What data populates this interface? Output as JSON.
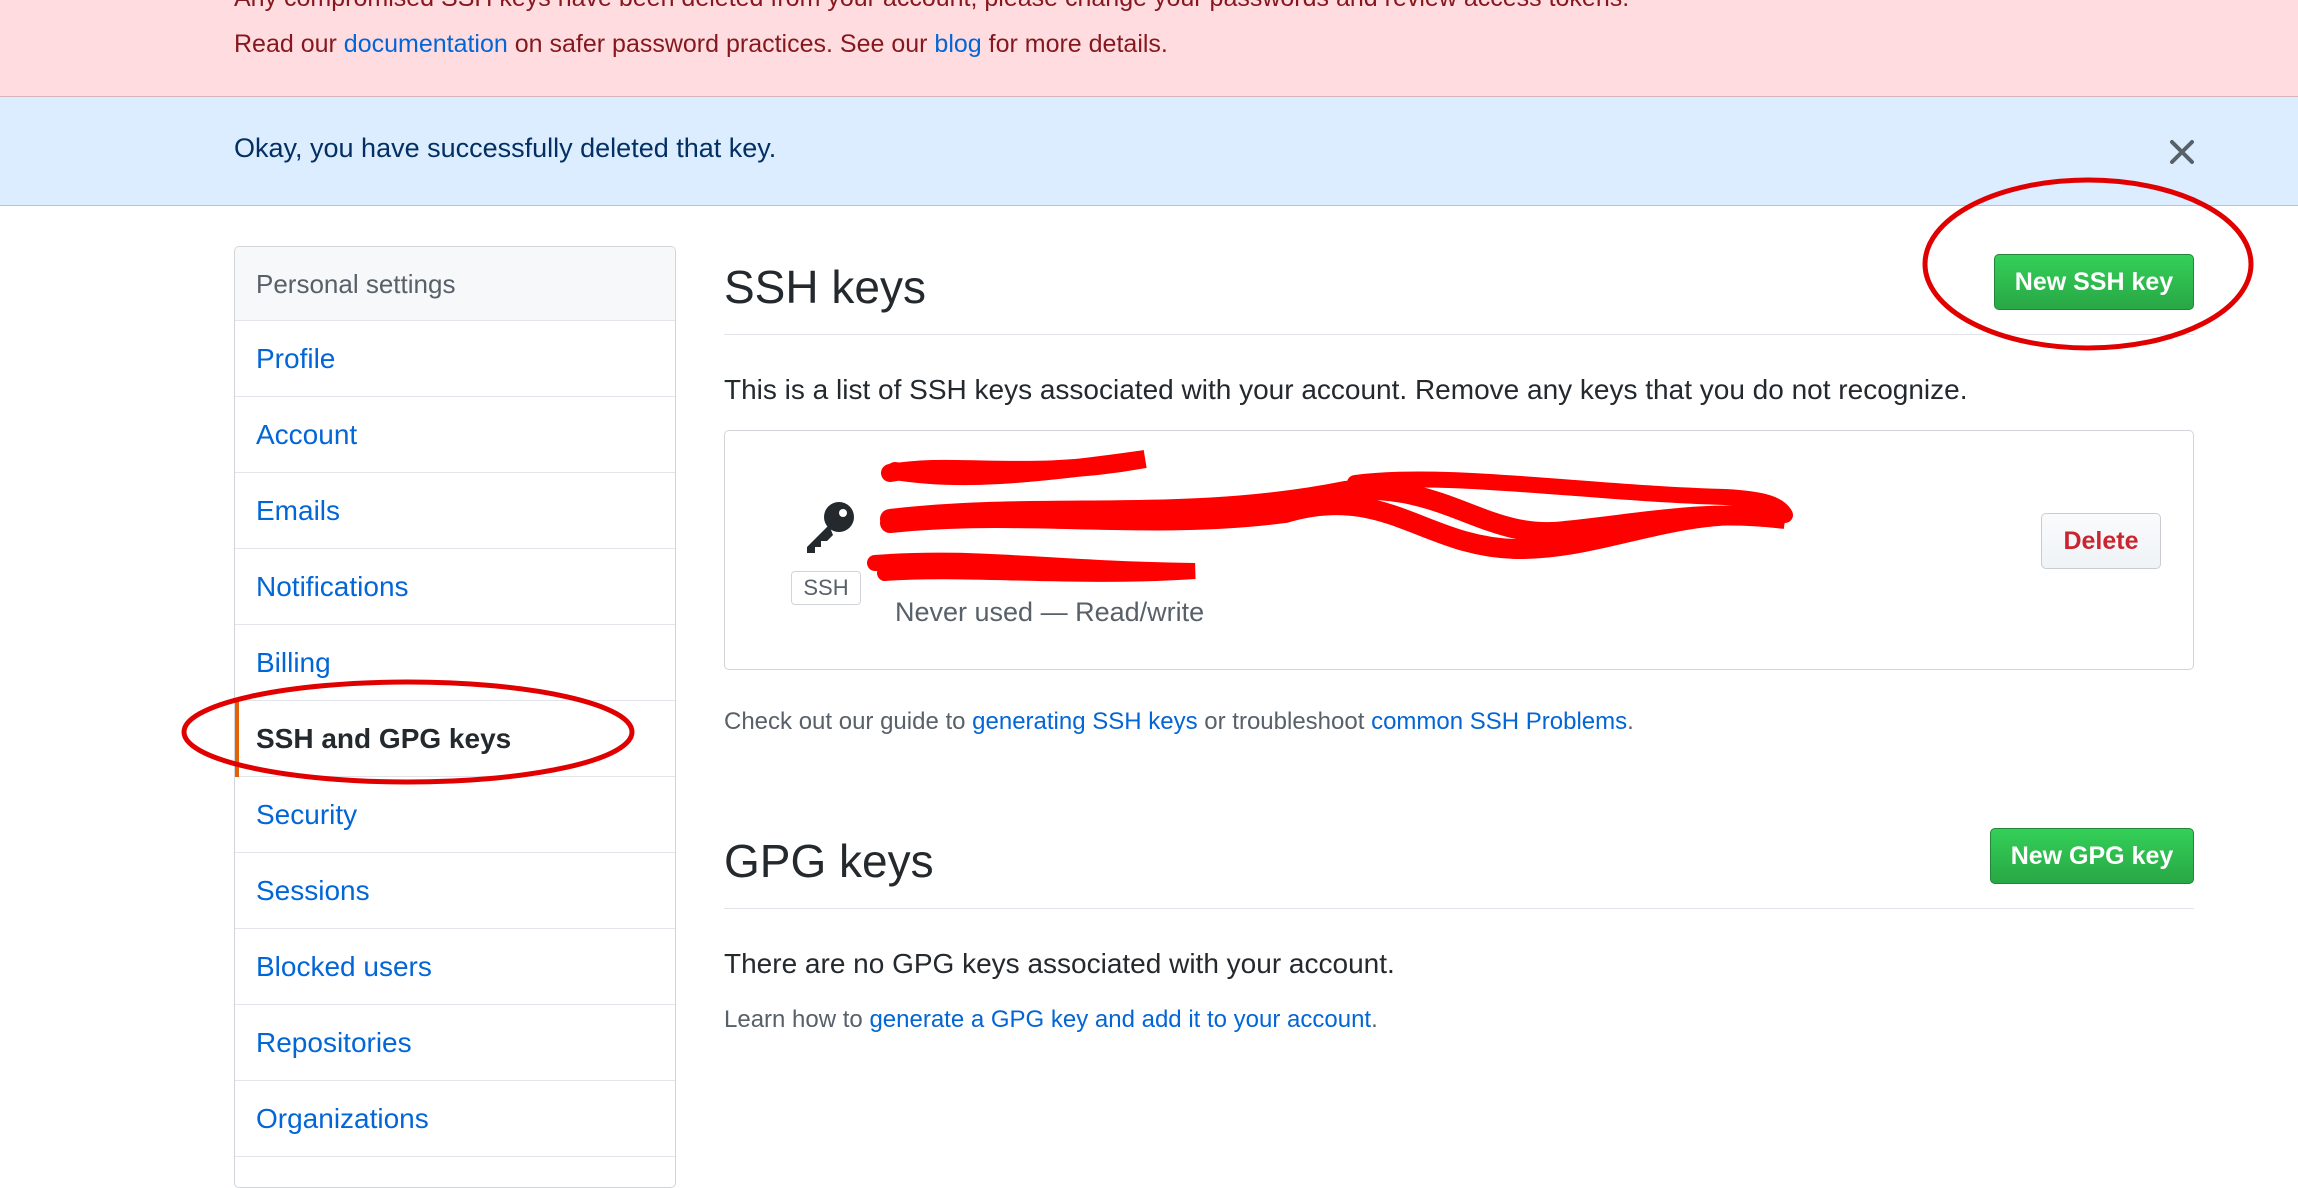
{
  "banners": {
    "error": {
      "clipped_line": "Any compromised SSH keys have been deleted from your account; please change your passwords and review access tokens.",
      "line_pre": "Read our ",
      "doc_link": "documentation",
      "line_mid": " on safer password practices. See our ",
      "blog_link": "blog",
      "line_post": " for more details."
    },
    "info": {
      "message": "Okay, you have successfully deleted that key.",
      "close_icon": "close-icon"
    }
  },
  "sidebar": {
    "header": "Personal settings",
    "items": [
      {
        "label": "Profile"
      },
      {
        "label": "Account"
      },
      {
        "label": "Emails"
      },
      {
        "label": "Notifications"
      },
      {
        "label": "Billing"
      },
      {
        "label": "SSH and GPG keys",
        "active": true
      },
      {
        "label": "Security"
      },
      {
        "label": "Sessions"
      },
      {
        "label": "Blocked users"
      },
      {
        "label": "Repositories"
      },
      {
        "label": "Organizations"
      }
    ]
  },
  "ssh": {
    "title": "SSH keys",
    "new_button": "New SSH key",
    "description": "This is a list of SSH keys associated with your account. Remove any keys that you do not recognize.",
    "key": {
      "type_badge": "SSH",
      "icon": "key-icon",
      "usage": "Never used — Read/write",
      "delete_button": "Delete"
    },
    "guide": {
      "pre": "Check out our guide to ",
      "link1": "generating SSH keys",
      "mid": " or troubleshoot ",
      "link2": "common SSH Problems",
      "post": "."
    }
  },
  "gpg": {
    "title": "GPG keys",
    "new_button": "New GPG key",
    "empty": "There are no GPG keys associated with your account.",
    "learn_pre": "Learn how to ",
    "learn_link": "generate a GPG key and add it to your account",
    "learn_post": "."
  },
  "colors": {
    "annotation": "#e00000",
    "link": "#0366d6",
    "active_marker": "#e36209"
  }
}
